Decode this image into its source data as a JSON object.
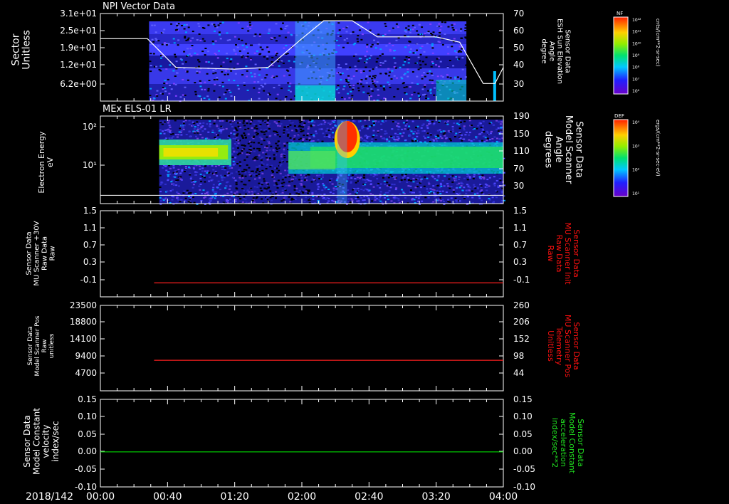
{
  "footer": {
    "date_label": "2018/142",
    "time_ticks": [
      "00:00",
      "00:40",
      "01:20",
      "02:00",
      "02:40",
      "03:20",
      "04:00"
    ]
  },
  "colors": {
    "frame": "#ffffff",
    "panel3_line": "#ff2020",
    "panel4_line": "#ff2020",
    "panel5_line": "#00e000",
    "red_label": "#ff1010",
    "green_label": "#20e020"
  },
  "colorbars": [
    {
      "label": "NF",
      "unit": "cnts/(cm**2-sr-sec)",
      "ticks": [
        "10¹²",
        "10¹¹",
        "10¹⁰",
        "10⁹",
        "10⁸",
        "10⁷",
        "10⁶"
      ]
    },
    {
      "label": "DEF",
      "unit": "ergs/(cm**2-sr-sec-eV)",
      "ticks": [
        "10⁴",
        "10³",
        "10²",
        "10¹"
      ]
    }
  ],
  "chart_data": [
    {
      "type": "heatmap",
      "title": "NPI Vector Data",
      "ylabel": [
        "Sector",
        "Unitless"
      ],
      "yticks": [
        "3.1e+01",
        "2.5e+01",
        "1.9e+01",
        "1.2e+01",
        "6.2e+00"
      ],
      "ylim": [
        0,
        31
      ],
      "y2label": [
        "Sensor Data",
        "ESH Sun Elevation",
        "Angle",
        "degree"
      ],
      "y2ticks": [
        "70",
        "60",
        "50",
        "40",
        "30"
      ],
      "y2lim": [
        20,
        70
      ],
      "xlim_minutes": [
        0,
        240
      ],
      "data_start_minutes": 29,
      "data_end_minutes": 218,
      "overlay_line": {
        "name": "ESH Sun Elevation",
        "x": [
          0,
          28,
          45,
          80,
          100,
          120,
          133,
          150,
          165,
          180,
          200,
          214,
          228,
          235,
          240
        ],
        "y": [
          56,
          56,
          40,
          39,
          40,
          56,
          66,
          66,
          57,
          57,
          57,
          54,
          31,
          31,
          40
        ]
      }
    },
    {
      "type": "heatmap",
      "title": "MEx ELS-01 LR",
      "ylabel": [
        "Electron Energy",
        "eV"
      ],
      "yticks": [
        "10²",
        "10¹"
      ],
      "yscale": "log",
      "y2label": [
        "Sensor Data",
        "Model Scanner",
        "Angle",
        "degrees"
      ],
      "y2ticks": [
        "190",
        "150",
        "110",
        "70",
        "30"
      ],
      "y2lim": [
        0,
        190
      ],
      "xlim_minutes": [
        0,
        240
      ],
      "data_start_minutes": 35,
      "overlay_line": {
        "name": "Model Scanner Angle",
        "x": [
          0,
          240
        ],
        "y": [
          18,
          18
        ]
      }
    },
    {
      "type": "line",
      "ylabel": [
        "Sensor Data",
        "MU Scanner +30V",
        "Raw Data",
        "Raw"
      ],
      "yticks": [
        "1.5",
        "1.1",
        "0.7",
        "0.3",
        "-0.1"
      ],
      "ylim": [
        -0.35,
        1.5
      ],
      "y2label": [
        "Sensor Data",
        "MU Scanner Init",
        "Raw Data",
        "Raw"
      ],
      "y2ticks": [
        "1.5",
        "1.1",
        "0.7",
        "0.3",
        "-0.1"
      ],
      "series": [
        {
          "x": [
            32,
            240
          ],
          "y": [
            -0.05,
            -0.05
          ]
        }
      ]
    },
    {
      "type": "line",
      "ylabel": [
        "Sensor Data",
        "Model Scanner Pos",
        "Raw",
        "unitless"
      ],
      "yticks": [
        "23500",
        "18800",
        "14100",
        "9400",
        "4700"
      ],
      "ylim": [
        0,
        23500
      ],
      "y2label": [
        "Sensor Data",
        "MU Scanner Pos",
        "Telemetry",
        "Unitless"
      ],
      "y2ticks": [
        "260",
        "206",
        "152",
        "98",
        "44"
      ],
      "y2lim": [
        0,
        260
      ],
      "series": [
        {
          "x": [
            32,
            240
          ],
          "y": [
            8400,
            8400
          ]
        }
      ]
    },
    {
      "type": "line",
      "ylabel": [
        "Sensor Data",
        "Model Constant",
        "velocity",
        "index/sec"
      ],
      "yticks": [
        "0.15",
        "0.10",
        "0.05",
        "0.00",
        "-0.05",
        "-0.10"
      ],
      "ylim": [
        -0.1,
        0.15
      ],
      "y2label": [
        "Sensor Data",
        "Model Constant",
        "acceleration",
        "index/sec**2"
      ],
      "y2ticks": [
        "0.15",
        "0.10",
        "0.05",
        "0.00",
        "-0.05",
        "-0.10"
      ],
      "series": [
        {
          "x": [
            0,
            240
          ],
          "y": [
            0,
            0
          ]
        }
      ]
    }
  ]
}
